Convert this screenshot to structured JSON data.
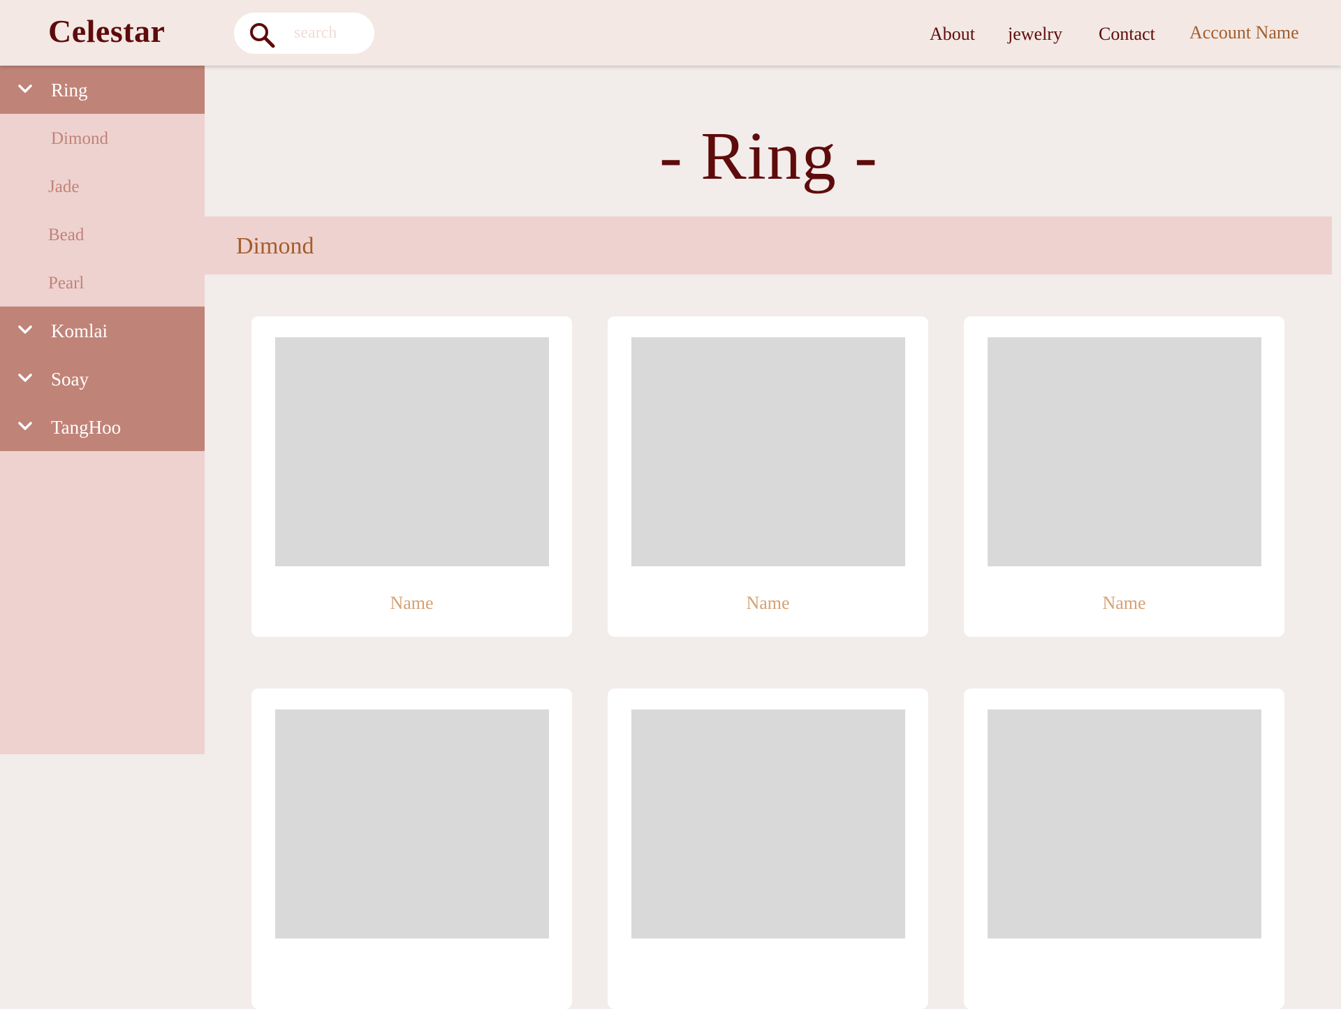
{
  "header": {
    "logo": "Celestar",
    "search": {
      "placeholder": "search",
      "value": ""
    },
    "nav": [
      {
        "label": "About"
      },
      {
        "label": "jewelry"
      },
      {
        "label": "Contact"
      }
    ],
    "account": "Account Name"
  },
  "sidebar": {
    "categories": [
      {
        "label": "Ring",
        "expanded": true,
        "items": [
          {
            "label": "Dimond"
          },
          {
            "label": "Jade"
          },
          {
            "label": "Bead"
          },
          {
            "label": "Pearl"
          }
        ]
      },
      {
        "label": "Komlai",
        "expanded": false
      },
      {
        "label": "Soay",
        "expanded": false
      },
      {
        "label": "TangHoo",
        "expanded": false
      }
    ]
  },
  "main": {
    "title": "- Ring -",
    "section": "Dimond",
    "products": [
      {
        "name": "Name"
      },
      {
        "name": "Name"
      },
      {
        "name": "Name"
      },
      {
        "name": ""
      },
      {
        "name": ""
      },
      {
        "name": ""
      }
    ]
  },
  "colors": {
    "header_bg": "#f3e8e4",
    "page_bg": "#f2ecea",
    "sidebar_bg": "#eed2cf",
    "category_bg": "#c08378",
    "accent_dark": "#5e0b0b",
    "accent_brown": "#a35d2e",
    "product_name": "#d6a172",
    "placeholder_image": "#d9d9d9"
  }
}
